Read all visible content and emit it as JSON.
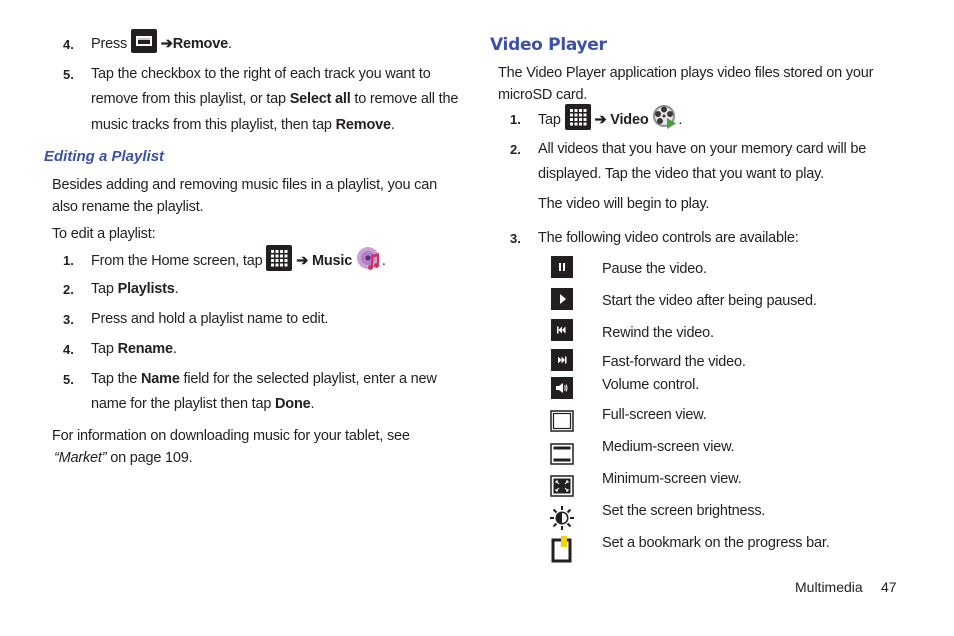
{
  "left": {
    "steps_top": [
      {
        "num": "4.",
        "pre": "Press",
        "arrow": "➔",
        "bold": "Remove",
        "post": "."
      },
      {
        "num": "5.",
        "lines": [
          "Tap the checkbox to the right of each track you want to",
          "remove from this playlist, or tap ",
          "Select all",
          " to remove all the",
          "music tracks from this playlist, then tap ",
          "Remove",
          "."
        ]
      }
    ],
    "editing_heading": "Editing a Playlist",
    "intro_line1": "Besides adding and removing music files in a playlist, you can",
    "intro_line2": "also rename the playlist.",
    "to_edit": "To edit a playlist:",
    "steps": [
      {
        "num": "1.",
        "pre": "From the Home screen, tap",
        "arrow": "➔",
        "bold": "Music",
        "post": "."
      },
      {
        "num": "2.",
        "pre": "Tap ",
        "bold": "Playlists",
        "post": "."
      },
      {
        "num": "3.",
        "text": "Press and hold a playlist name to edit."
      },
      {
        "num": "4.",
        "pre": "Tap ",
        "bold": "Rename",
        "post": "."
      },
      {
        "num": "5.",
        "pre": "Tap the ",
        "bold": "Name",
        "post": " field for the selected playlist, enter a new",
        "line2_pre": "name for the playlist then tap ",
        "line2_bold": "Done",
        "line2_post": "."
      }
    ],
    "info_line1": "For information on downloading music for your tablet, see",
    "info_link": "“Market”",
    "info_line2_post": " on page 109."
  },
  "right": {
    "heading": "Video Player",
    "intro_line1": "The Video Player application plays video files stored on your",
    "intro_line2": "microSD card.",
    "steps": [
      {
        "num": "1.",
        "pre": "Tap",
        "arrow": "➔",
        "bold": "Video",
        "post": "."
      },
      {
        "num": "2.",
        "line1": "All videos that you have on your memory card will be",
        "line2": "displayed. Tap the video that you want to play.",
        "note": "The video will begin to play."
      },
      {
        "num": "3.",
        "text": "The following video controls are available:"
      }
    ],
    "controls": [
      {
        "icon": "pause-icon",
        "label": "Pause the video."
      },
      {
        "icon": "play-icon",
        "label": "Start the video after being paused."
      },
      {
        "icon": "rewind-icon",
        "label": "Rewind the video."
      },
      {
        "icon": "fast-forward-icon",
        "label": "Fast-forward the video."
      },
      {
        "icon": "volume-icon",
        "label": "Volume control."
      },
      {
        "icon": "full-screen-icon",
        "label": "Full-screen view."
      },
      {
        "icon": "medium-screen-icon",
        "label": "Medium-screen view."
      },
      {
        "icon": "minimum-screen-icon",
        "label": "Minimum-screen view."
      },
      {
        "icon": "brightness-icon",
        "label": "Set the screen brightness."
      },
      {
        "icon": "bookmark-icon",
        "label": "Set a bookmark on the progress bar."
      }
    ]
  },
  "footer": {
    "section": "Multimedia",
    "page": "47"
  },
  "colors": {
    "heading": "#3b52a8",
    "text": "#231f20",
    "bookmark": "#f5d20a"
  }
}
